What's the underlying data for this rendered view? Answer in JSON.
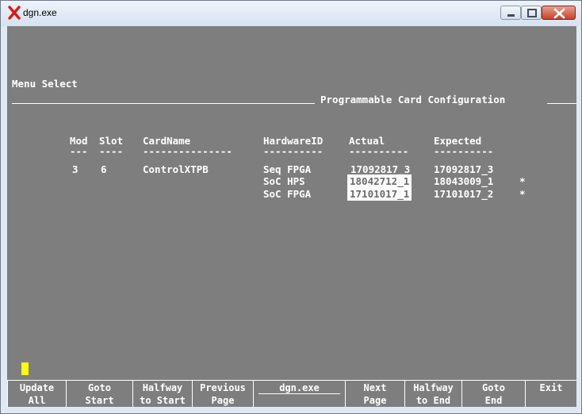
{
  "window": {
    "title": "dgn.exe",
    "icon": "x-app-icon"
  },
  "screen": {
    "menu_label": "Menu Select",
    "heading": "Programmable Card Configuration",
    "columns": {
      "mod": "Mod",
      "slot": "Slot",
      "card_name": "CardName",
      "hardware_id": "HardwareID",
      "actual": "Actual",
      "expected": "Expected"
    },
    "separators": {
      "mod": "---",
      "slot": "----",
      "card_name": "---------------",
      "hardware_id": "----------",
      "actual": "----------",
      "expected": "----------"
    },
    "rows": [
      {
        "mod": "3",
        "slot": "6",
        "card_name": "ControlXTPB",
        "hardware_id": "Seq FPGA",
        "actual": "17092817_3",
        "expected": "17092817_3",
        "flag": ""
      },
      {
        "mod": "",
        "slot": "",
        "card_name": "",
        "hardware_id": "SoC HPS",
        "actual": "18042712_1",
        "expected": "18043009_1",
        "flag": "*"
      },
      {
        "mod": "",
        "slot": "",
        "card_name": "",
        "hardware_id": "SoC FPGA",
        "actual": "17101017_1",
        "expected": "17101017_2",
        "flag": "*"
      }
    ]
  },
  "function_keys": [
    {
      "line1": "Update",
      "line2": "All"
    },
    {
      "line1": "Goto",
      "line2": "Start"
    },
    {
      "line1": "Halfway",
      "line2": "to Start"
    },
    {
      "line1": "Previous",
      "line2": "Page"
    },
    {
      "line1": "dgn.exe",
      "line2": ""
    },
    {
      "line1": "Next",
      "line2": "Page"
    },
    {
      "line1": "Halfway",
      "line2": "to End"
    },
    {
      "line1": "Goto",
      "line2": "End"
    },
    {
      "line1": "Exit",
      "line2": ""
    }
  ],
  "colors": {
    "terminal_bg": "#7e7e7e",
    "cursor": "#ffff00",
    "close_button": "#c4422c"
  }
}
